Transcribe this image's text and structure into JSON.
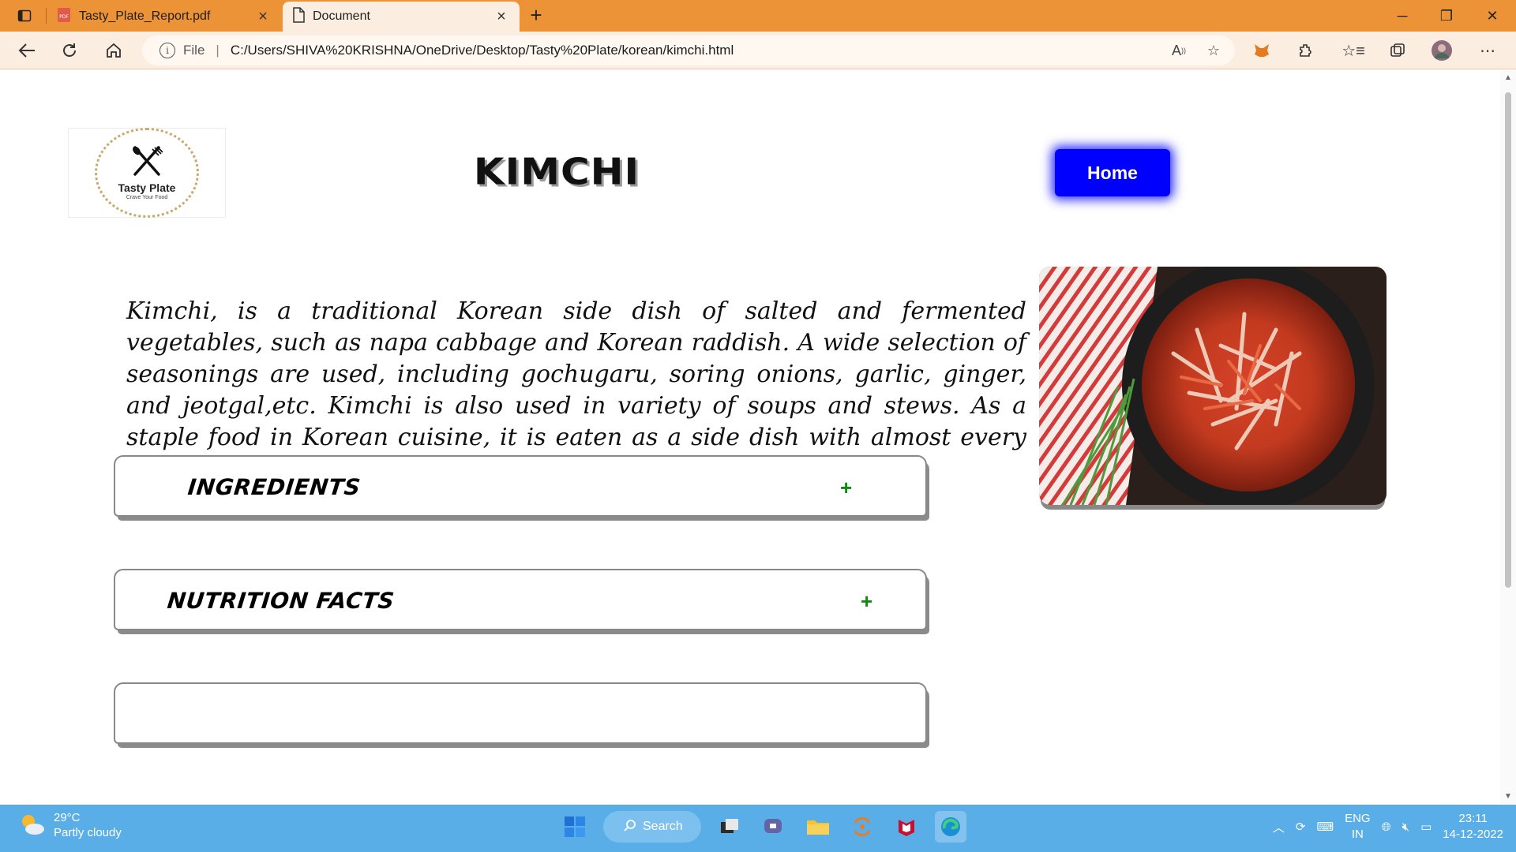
{
  "browser": {
    "tabs": [
      {
        "title": "Tasty_Plate_Report.pdf",
        "active": false
      },
      {
        "title": "Document",
        "active": true
      }
    ],
    "address_prefix": "File",
    "url": "C:/Users/SHIVA%20KRISHNA/OneDrive/Desktop/Tasty%20Plate/korean/kimchi.html"
  },
  "page": {
    "logo": {
      "name": "Tasty Plate",
      "tagline": "Crave Your Food"
    },
    "title": "KIMCHI",
    "home_button": "Home",
    "description": "Kimchi, is a traditional Korean side dish of salted and fermented vegetables, such as napa cabbage and Korean raddish. A wide selection of seasonings are used, including gochugaru, soring onions, garlic, ginger, and jeotgal,etc. Kimchi is also used in variety of soups and stews. As a staple food in Korean cuisine, it is eaten as a side dish with almost every Korean meal.",
    "sections": [
      {
        "label": "INGREDIENTS",
        "toggle": "+"
      },
      {
        "label": "NUTRITION FACTS",
        "toggle": "+"
      },
      {
        "label": "",
        "toggle": ""
      }
    ]
  },
  "taskbar": {
    "weather": {
      "temp": "29°C",
      "condition": "Partly cloudy"
    },
    "search_label": "Search",
    "language": {
      "line1": "ENG",
      "line2": "IN"
    },
    "clock": {
      "time": "23:11",
      "date": "14-12-2022"
    }
  },
  "colors": {
    "accent": "#ec9237",
    "home_button": "#0000ff",
    "plus": "#118a11",
    "taskbar": "#5aaee8"
  }
}
